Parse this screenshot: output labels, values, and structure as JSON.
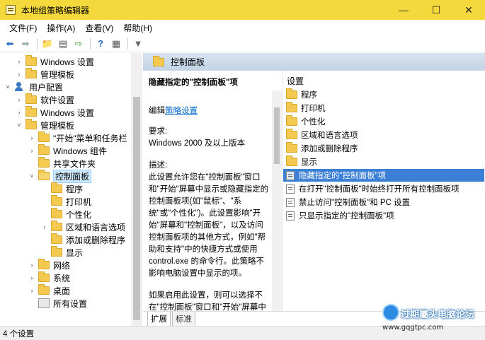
{
  "window": {
    "title": "本地组策略编辑器",
    "controls": {
      "minimize": "—",
      "maximize": "☐",
      "close": "✕"
    }
  },
  "menu": [
    "文件(F)",
    "操作(A)",
    "查看(V)",
    "帮助(H)"
  ],
  "toolbar": {
    "icons": [
      "back-arrow-icon",
      "forward-arrow-icon",
      "up-folder-icon",
      "show-hide-tree-icon",
      "export-list-icon",
      "help-icon",
      "properties-icon",
      "filter-icon"
    ]
  },
  "tree": [
    {
      "label": "Windows 设置",
      "arrow": "›",
      "type": "folder"
    },
    {
      "label": "管理模板",
      "arrow": "›",
      "type": "folder"
    },
    {
      "label": "用户配置",
      "arrow": "˅",
      "type": "user"
    },
    {
      "label": "软件设置",
      "arrow": "›",
      "type": "folder"
    },
    {
      "label": "Windows 设置",
      "arrow": "›",
      "type": "folder"
    },
    {
      "label": "管理模板",
      "arrow": "˅",
      "type": "folder"
    },
    {
      "label": "\"开始\"菜单和任务栏",
      "arrow": "›",
      "type": "folder"
    },
    {
      "label": "Windows 组件",
      "arrow": "›",
      "type": "folder"
    },
    {
      "label": "共享文件夹",
      "arrow": "",
      "type": "folder"
    },
    {
      "label": "控制面板",
      "arrow": "˅",
      "type": "folder",
      "selected": true
    },
    {
      "label": "程序",
      "arrow": "",
      "type": "folder"
    },
    {
      "label": "打印机",
      "arrow": "",
      "type": "folder"
    },
    {
      "label": "个性化",
      "arrow": "",
      "type": "folder"
    },
    {
      "label": "区域和语言选项",
      "arrow": "›",
      "type": "folder"
    },
    {
      "label": "添加或删除程序",
      "arrow": "",
      "type": "folder"
    },
    {
      "label": "显示",
      "arrow": "",
      "type": "folder"
    },
    {
      "label": "网络",
      "arrow": "›",
      "type": "folder"
    },
    {
      "label": "系统",
      "arrow": "›",
      "type": "folder"
    },
    {
      "label": "桌面",
      "arrow": "›",
      "type": "folder"
    },
    {
      "label": "所有设置",
      "arrow": "",
      "type": "allsettings"
    }
  ],
  "header": {
    "title": "控制面板"
  },
  "description": {
    "title": "隐藏指定的\"控制面板\"项",
    "edit_prefix": "编辑",
    "edit_link": "策略设置",
    "requirement_label": "要求:",
    "requirement_value": "Windows 2000 及以上版本",
    "desc_label": "描述:",
    "desc_text": "此设置允许您在\"控制面板\"窗口和\"开始\"屏幕中显示或隐藏指定的控制面板项(如\"鼠标\"、\"系统\"或\"个性化\")。此设置影响\"开始\"屏幕和\"控制面板\"，以及访问控制面板项的其他方式，例如\"帮助和支持\"中的快捷方式或使用 control.exe 的命令行。此策略不影响电脑设置中显示的项。",
    "desc_text2": "如果启用此设置，则可以选择不在\"控制面板\"窗口和\"开始\"屏幕中显示的特定项。"
  },
  "settings": {
    "header": "设置",
    "folders": [
      "程序",
      "打印机",
      "个性化",
      "区域和语言选项",
      "添加或删除程序",
      "显示"
    ],
    "policies": [
      {
        "label": "隐藏指定的\"控制面板\"项",
        "selected": true
      },
      {
        "label": "在打开\"控制面板\"时始终打开所有控制面板项"
      },
      {
        "label": "禁止访问\"控制面板\"和 PC 设置"
      },
      {
        "label": "只显示指定的\"控制面板\"项"
      }
    ]
  },
  "tabs": [
    "扩展",
    "标准"
  ],
  "status": "4 个设置",
  "watermark": {
    "site_name": "过期屬头电脑论坛",
    "url": "www.gqgtpc.com"
  }
}
